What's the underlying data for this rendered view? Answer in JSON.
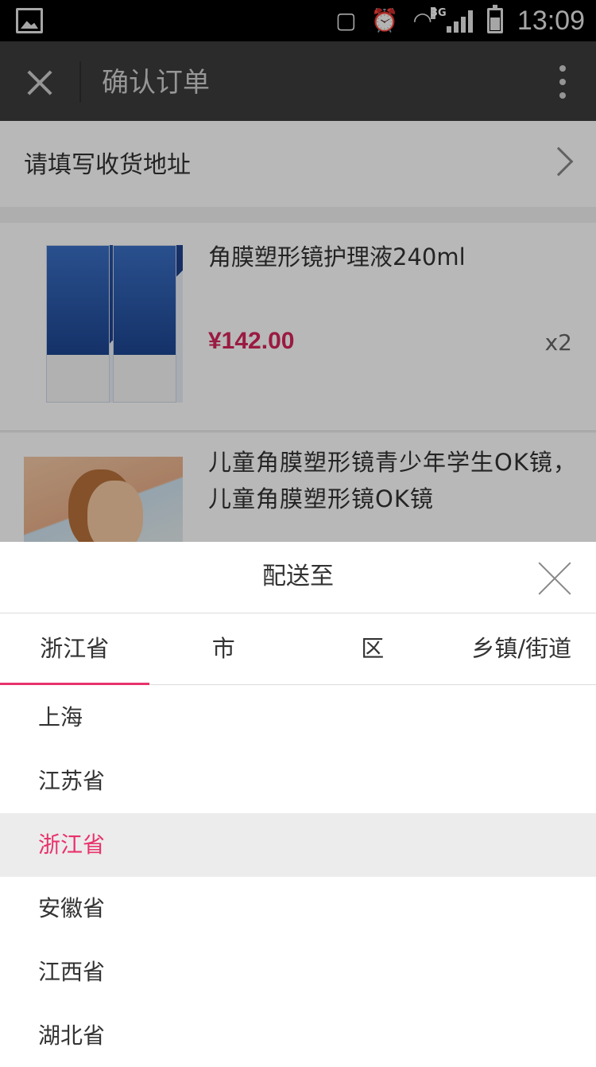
{
  "status_bar": {
    "time": "13:09",
    "network": "3G",
    "icons": [
      "gallery-icon",
      "vibrate-icon",
      "alarm-icon",
      "wifi-icon",
      "signal-icon",
      "battery-icon"
    ]
  },
  "app_bar": {
    "title": "确认订单",
    "close_icon": "close-icon",
    "more_icon": "more-vertical-icon"
  },
  "address": {
    "placeholder": "请填写收货地址"
  },
  "products": [
    {
      "title": "角膜塑形镜护理液240ml",
      "price": "¥142.00",
      "quantity": "x2"
    },
    {
      "title": "儿童角膜塑形镜青少年学生OK镜，儿童角膜塑形镜OK镜"
    }
  ],
  "sheet": {
    "title": "配送至",
    "tabs": [
      {
        "label": "浙江省",
        "active": true
      },
      {
        "label": "市",
        "active": false
      },
      {
        "label": "区",
        "active": false
      },
      {
        "label": "乡镇/街道",
        "active": false
      }
    ],
    "options": [
      {
        "label": "上海",
        "selected": false
      },
      {
        "label": "江苏省",
        "selected": false
      },
      {
        "label": "浙江省",
        "selected": true
      },
      {
        "label": "安徽省",
        "selected": false
      },
      {
        "label": "江西省",
        "selected": false
      },
      {
        "label": "湖北省",
        "selected": false
      }
    ]
  },
  "colors": {
    "accent": "#e8336d",
    "price": "#d6245c",
    "app_bar": "#3c3c3c"
  }
}
